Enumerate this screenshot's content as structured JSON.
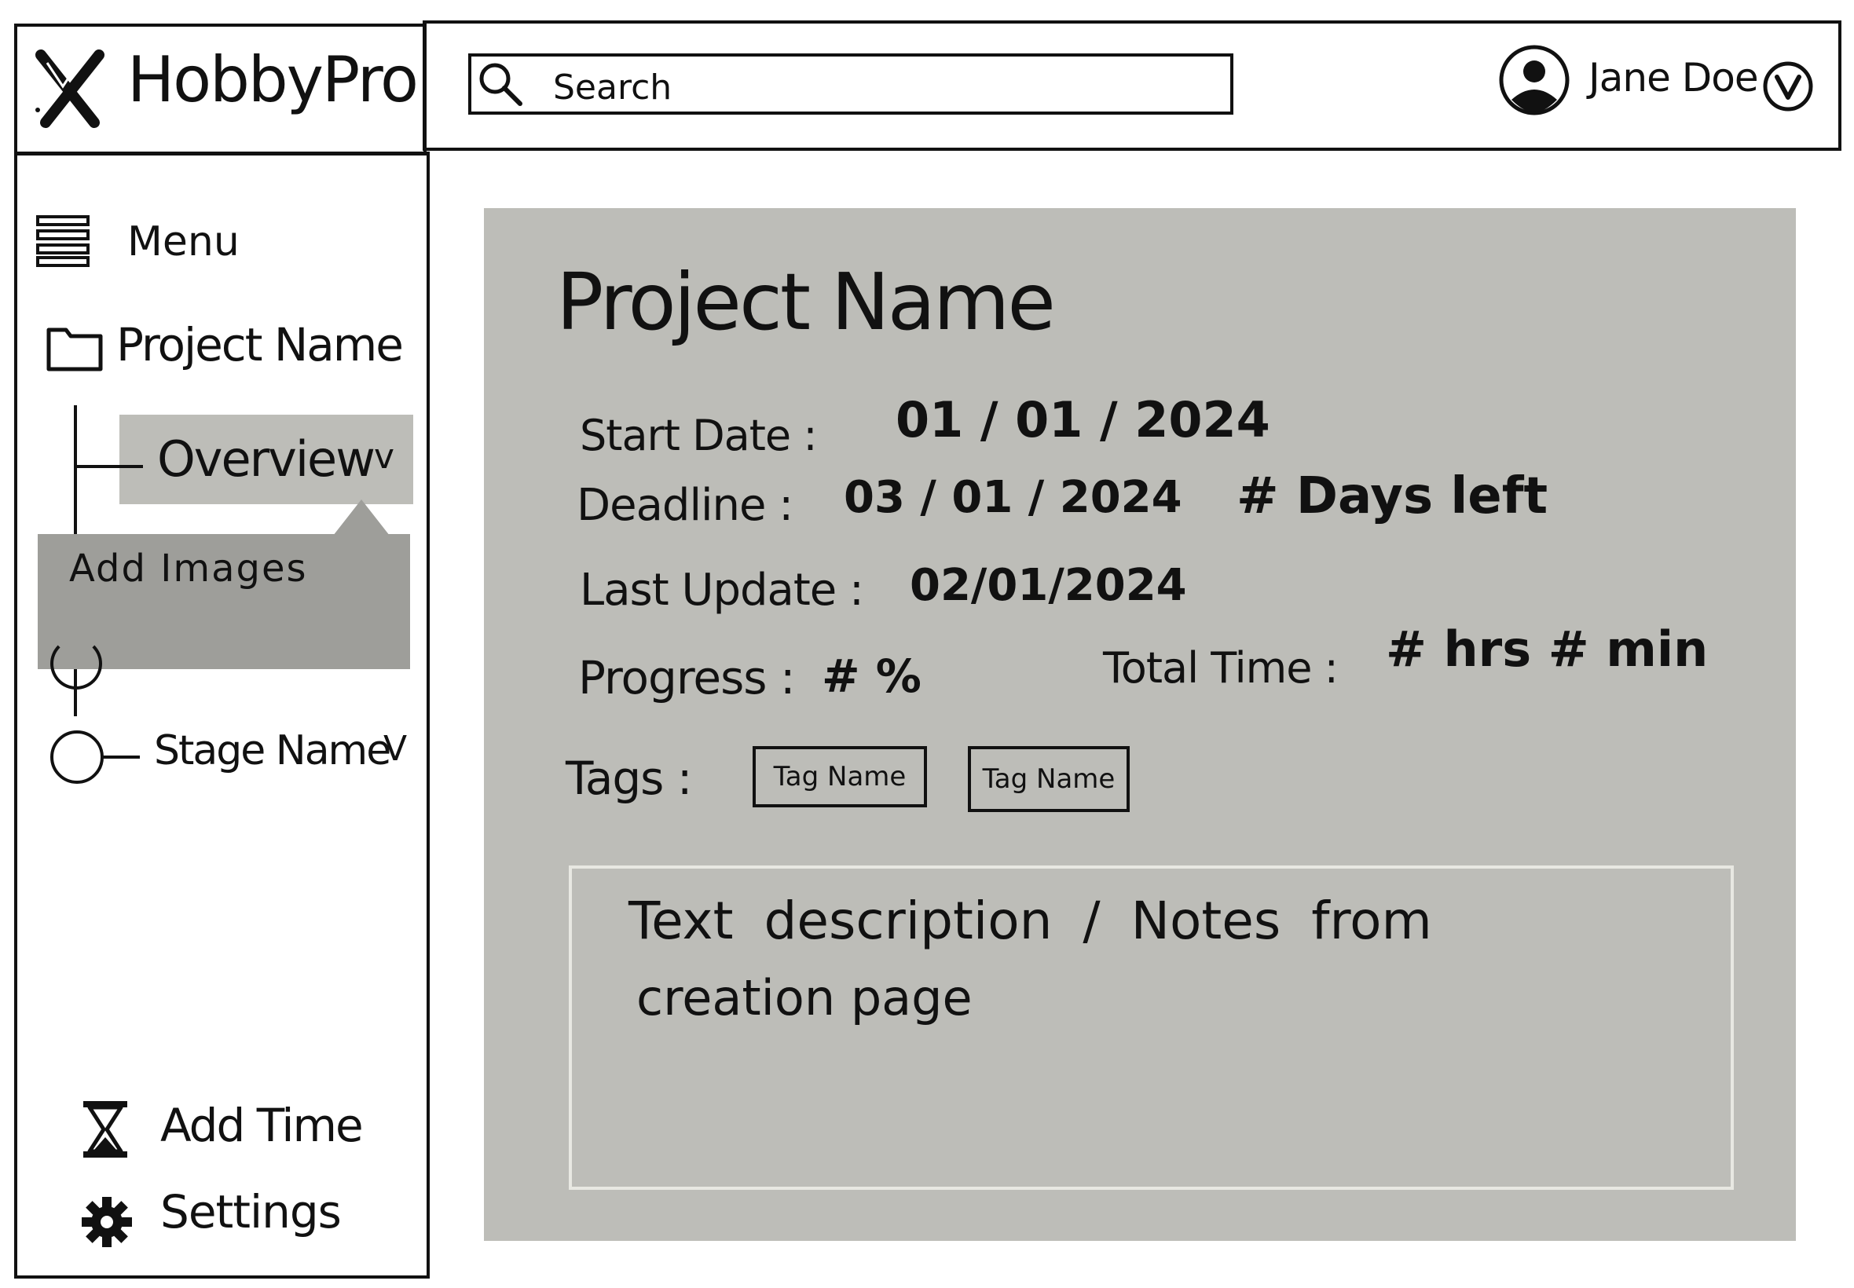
{
  "app": {
    "name": "HobbyPro"
  },
  "header": {
    "search_label": "Search",
    "user_name": "Jane Doe"
  },
  "sidebar": {
    "menu_label": "Menu",
    "project_label": "Project Name",
    "overview_label": "Overview",
    "overview_chevron": "v",
    "popup_item": "Add Images",
    "stage_label": "Stage Name",
    "stage_chevron": "V",
    "add_time_label": "Add Time",
    "settings_label": "Settings"
  },
  "project": {
    "title": "Project Name",
    "start_label": "Start Date :",
    "start_value": "01 / 01 / 2024",
    "deadline_label": "Deadline :",
    "deadline_value": "03 / 01 / 2024",
    "days_left": "# Days left",
    "last_update_label": "Last Update :",
    "last_update_value": "02/01/2024",
    "progress_label": "Progress :",
    "progress_value": "# %",
    "total_time_label": "Total Time :",
    "total_time_value": "# hrs # min",
    "tags_label": "Tags :",
    "tags": [
      "Tag Name",
      "Tag Name"
    ],
    "notes_line1": "Text description / Notes from",
    "notes_line2": "creation page"
  },
  "colors": {
    "panel": "#bdbdb8",
    "popup": "#9e9e9a",
    "ink": "#111111"
  },
  "icons": [
    "logo-icon",
    "search-icon",
    "avatar-icon",
    "chevron-down-icon",
    "hamburger-icon",
    "folder-icon",
    "hourglass-icon",
    "gear-icon"
  ]
}
